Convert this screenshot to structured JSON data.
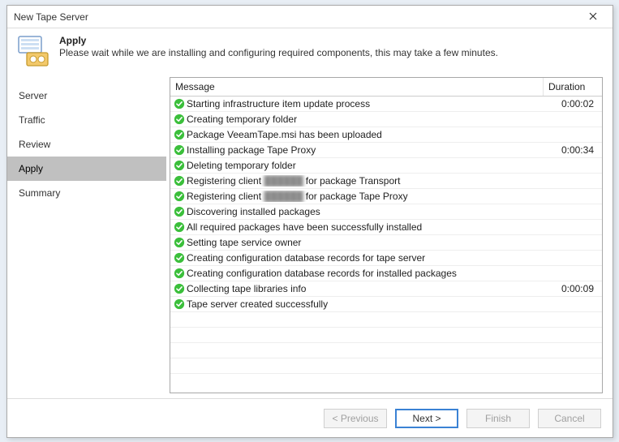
{
  "window": {
    "title": "New Tape Server"
  },
  "header": {
    "title": "Apply",
    "desc": "Please wait while we are installing and configuring required components, this may take a few minutes."
  },
  "sidebar": {
    "items": [
      {
        "label": "Server",
        "active": false
      },
      {
        "label": "Traffic",
        "active": false
      },
      {
        "label": "Review",
        "active": false
      },
      {
        "label": "Apply",
        "active": true
      },
      {
        "label": "Summary",
        "active": false
      }
    ]
  },
  "grid": {
    "columns": {
      "message": "Message",
      "duration": "Duration"
    },
    "rows": [
      {
        "status": "ok",
        "message": "Starting infrastructure item update process",
        "duration": "0:00:02"
      },
      {
        "status": "ok",
        "message": "Creating temporary folder",
        "duration": ""
      },
      {
        "status": "ok",
        "message": "Package VeeamTape.msi has been uploaded",
        "duration": ""
      },
      {
        "status": "ok",
        "message": "Installing package Tape Proxy",
        "duration": "0:00:34"
      },
      {
        "status": "ok",
        "message": "Deleting temporary folder",
        "duration": ""
      },
      {
        "status": "ok",
        "message_parts": [
          "Registering client ",
          "REDACT",
          " for package Transport"
        ],
        "duration": ""
      },
      {
        "status": "ok",
        "message_parts": [
          "Registering client ",
          "REDACT",
          " for package Tape Proxy"
        ],
        "duration": ""
      },
      {
        "status": "ok",
        "message": "Discovering installed packages",
        "duration": ""
      },
      {
        "status": "ok",
        "message": "All required packages have been successfully installed",
        "duration": ""
      },
      {
        "status": "ok",
        "message": "Setting tape service owner",
        "duration": ""
      },
      {
        "status": "ok",
        "message": "Creating configuration database records for tape server",
        "duration": ""
      },
      {
        "status": "ok",
        "message": "Creating configuration database records for installed packages",
        "duration": ""
      },
      {
        "status": "ok",
        "message": "Collecting tape libraries info",
        "duration": "0:00:09"
      },
      {
        "status": "ok",
        "message": "Tape server created successfully",
        "duration": ""
      }
    ],
    "blank_rows": 4
  },
  "footer": {
    "previous": "< Previous",
    "next": "Next >",
    "finish": "Finish",
    "cancel": "Cancel"
  },
  "icons": {
    "ok_color": "#3bbf3b"
  }
}
